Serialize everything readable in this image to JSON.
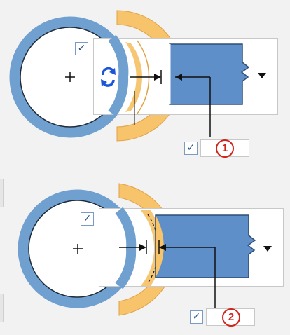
{
  "colors": {
    "ring": "#6fa0d0",
    "ring_dark": "#3f6f9f",
    "shell": "#f7c36b",
    "shell_edge": "#e0a347",
    "rect_fill": "#5f8fc9",
    "line": "#111111",
    "badge": "#d0241b",
    "rotate_icon": "#1a56d6"
  },
  "diagrams": [
    {
      "checkbox_top": "✓",
      "checkbox_bottom": "✓",
      "badge": "1",
      "icons": [
        "crosshair-icon",
        "rotate-icon",
        "dropdown-arrow-icon"
      ]
    },
    {
      "checkbox_top": "✓",
      "checkbox_bottom": "✓",
      "badge": "2",
      "icons": [
        "crosshair-icon",
        "dropdown-arrow-icon"
      ]
    }
  ]
}
